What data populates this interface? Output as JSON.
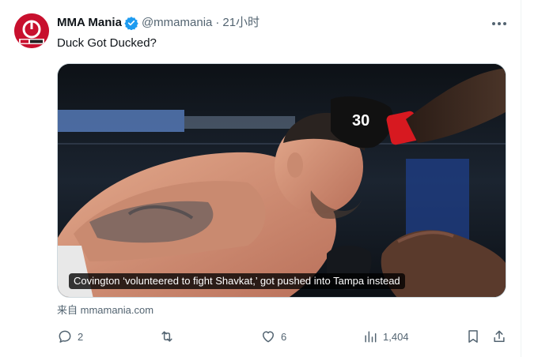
{
  "tweet": {
    "display_name": "MMA Mania",
    "handle": "@mmamania",
    "separator": "·",
    "time": "21小时",
    "text": "Duck Got Ducked?",
    "media_caption": "Covington ‘volunteered to fight Shavkat,’ got pushed into Tampa instead",
    "source": "来自 mmamania.com"
  },
  "actions": {
    "replies": "2",
    "retweets": "",
    "likes": "6",
    "views": "1,404"
  },
  "icons": {
    "verified": "verified-badge-icon",
    "more": "more-dots-icon",
    "reply": "reply-icon",
    "retweet": "retweet-icon",
    "like": "heart-icon",
    "views": "views-chart-icon",
    "bookmark": "bookmark-icon",
    "share": "share-icon"
  },
  "colors": {
    "verified": "#1d9bf0",
    "avatar": "#c8102e",
    "text": "#0f1419",
    "muted": "#536471"
  }
}
